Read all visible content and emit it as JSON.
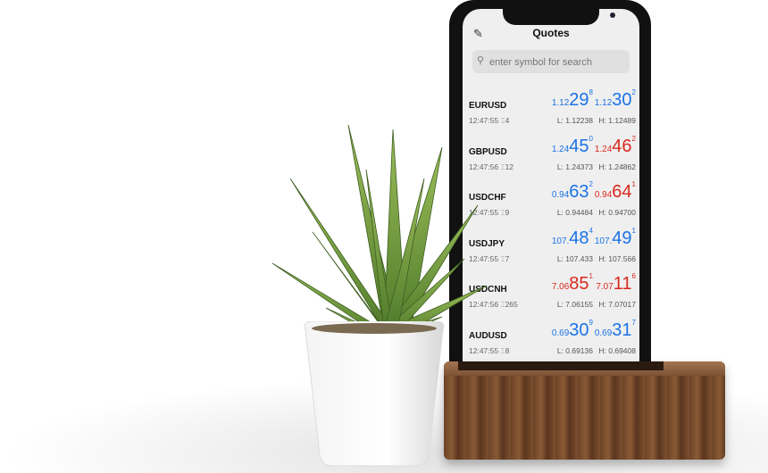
{
  "screen": {
    "title": "Quotes",
    "edit_icon": "pencil-icon",
    "search_placeholder": "enter symbol for search",
    "colors": {
      "up": "#1a73e8",
      "down": "#d9281e"
    },
    "quotes": [
      {
        "symbol": "EURUSD",
        "time": "12:47:55",
        "spread": "4",
        "bid": {
          "pre": "1.12",
          "big": "29",
          "sup": "8",
          "dir": "up"
        },
        "ask": {
          "pre": "1.12",
          "big": "30",
          "sup": "2",
          "dir": "up"
        },
        "low": "L: 1.12238",
        "high": "H: 1.12489"
      },
      {
        "symbol": "GBPUSD",
        "time": "12:47:56",
        "spread": "12",
        "bid": {
          "pre": "1.24",
          "big": "45",
          "sup": "0",
          "dir": "up"
        },
        "ask": {
          "pre": "1.24",
          "big": "46",
          "sup": "2",
          "dir": "down"
        },
        "low": "L: 1.24373",
        "high": "H: 1.24862"
      },
      {
        "symbol": "USDCHF",
        "time": "12:47:55",
        "spread": "9",
        "bid": {
          "pre": "0.94",
          "big": "63",
          "sup": "2",
          "dir": "up"
        },
        "ask": {
          "pre": "0.94",
          "big": "64",
          "sup": "1",
          "dir": "down"
        },
        "low": "L: 0.94484",
        "high": "H: 0.94700"
      },
      {
        "symbol": "USDJPY",
        "time": "12:47:55",
        "spread": "7",
        "bid": {
          "pre": "107.",
          "big": "48",
          "sup": "4",
          "dir": "up"
        },
        "ask": {
          "pre": "107.",
          "big": "49",
          "sup": "1",
          "dir": "up"
        },
        "low": "L: 107.433",
        "high": "H: 107.566"
      },
      {
        "symbol": "USDCNH",
        "time": "12:47:56",
        "spread": "265",
        "bid": {
          "pre": "7.06",
          "big": "85",
          "sup": "1",
          "dir": "down"
        },
        "ask": {
          "pre": "7.07",
          "big": "11",
          "sup": "6",
          "dir": "down"
        },
        "low": "L: 7.06155",
        "high": "H: 7.07017"
      },
      {
        "symbol": "AUDUSD",
        "time": "12:47:55",
        "spread": "8",
        "bid": {
          "pre": "0.69",
          "big": "30",
          "sup": "9",
          "dir": "up"
        },
        "ask": {
          "pre": "0.69",
          "big": "31",
          "sup": "7",
          "dir": "up"
        },
        "low": "L: 0.69136",
        "high": "H: 0.69408"
      }
    ]
  }
}
